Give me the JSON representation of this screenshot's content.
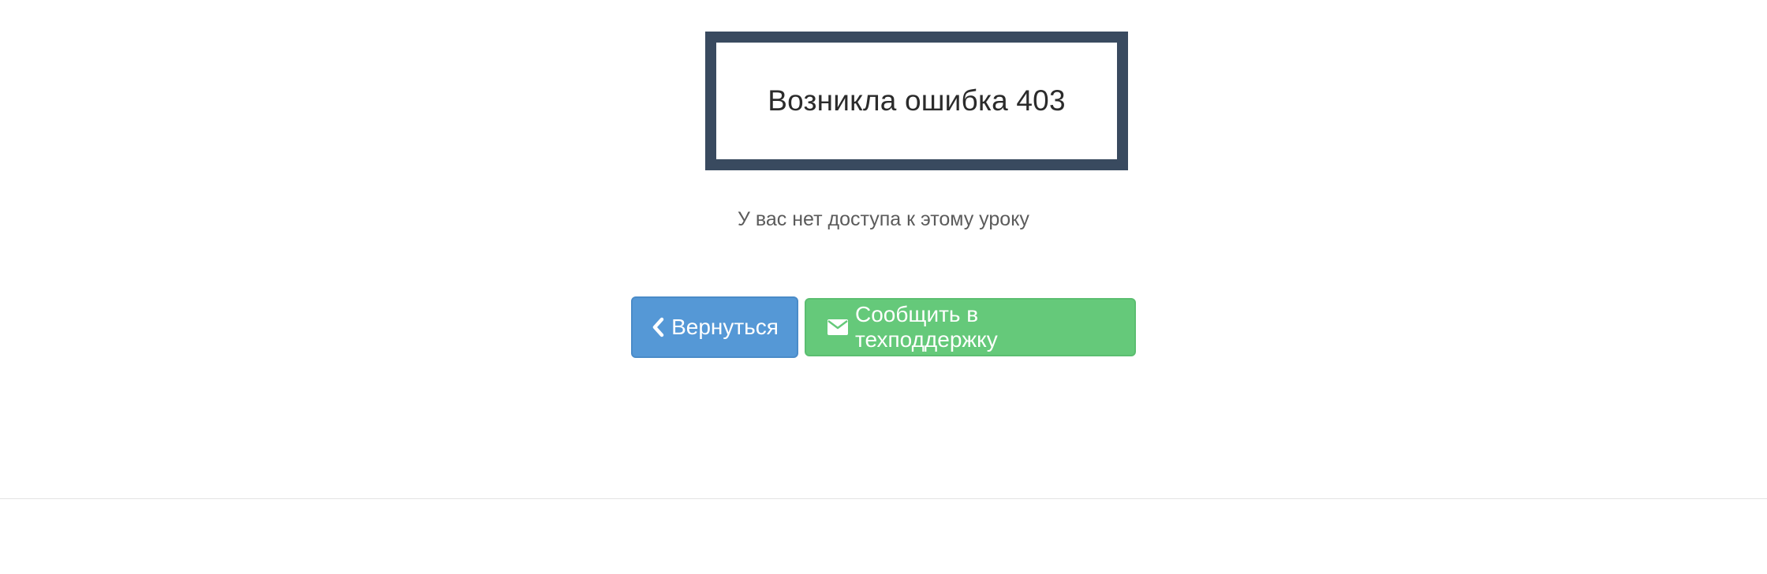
{
  "error": {
    "title": "Возникла ошибка 403",
    "message": "У вас нет доступа к этому уроку"
  },
  "actions": {
    "back_label": "Вернуться",
    "support_label": "Сообщить в техподдержку"
  },
  "icons": {
    "back": "chevron-left-icon",
    "support": "envelope-icon"
  },
  "colors": {
    "box_border": "#394a5f",
    "back_button": "#5598d6",
    "support_button": "#65c97a"
  }
}
